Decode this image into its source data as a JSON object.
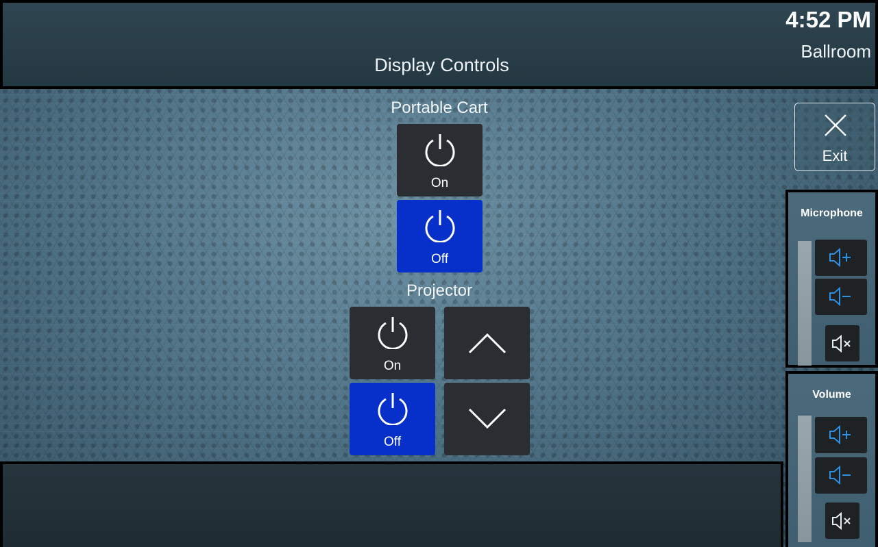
{
  "header": {
    "title": "Display Controls",
    "time": "4:52 PM",
    "room": "Ballroom"
  },
  "portable_cart": {
    "label": "Portable Cart",
    "on_label": "On",
    "off_label": "Off",
    "state": "off"
  },
  "projector": {
    "label": "Projector",
    "on_label": "On",
    "off_label": "Off",
    "state": "off",
    "up_icon": "chevron-up-icon",
    "down_icon": "chevron-down-icon"
  },
  "exit": {
    "label": "Exit",
    "icon": "close-icon"
  },
  "microphone": {
    "title": "Microphone",
    "icons": [
      "volume-up-icon",
      "volume-down-icon",
      "mute-icon"
    ]
  },
  "volume": {
    "title": "Volume",
    "icons": [
      "volume-up-icon",
      "volume-down-icon",
      "mute-icon"
    ]
  },
  "colors": {
    "active_blue": "#0630c9",
    "button_dark": "#2a2d31",
    "icon_blue": "#2f8fe0",
    "frame": "#000000"
  }
}
